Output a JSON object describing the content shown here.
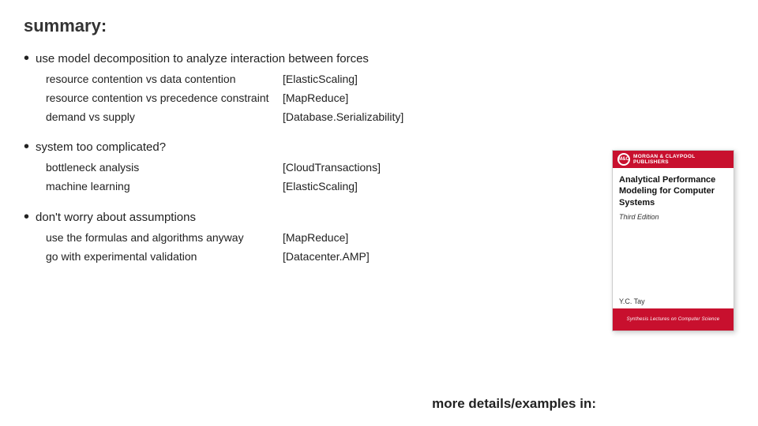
{
  "header": {
    "title": "summary:"
  },
  "bullets": [
    {
      "id": "bullet1",
      "text": "use model decomposition to analyze interaction between forces",
      "indent_items": [
        {
          "label": "resource contention vs data contention",
          "ref": "[ElasticScaling]"
        },
        {
          "label": "resource contention vs precedence constraint",
          "ref": "[MapReduce]"
        },
        {
          "label": "demand vs supply",
          "ref": "[Database.Serializability]"
        }
      ]
    },
    {
      "id": "bullet2",
      "text": "system too complicated?",
      "indent_items": [
        {
          "label": "bottleneck analysis",
          "ref": "[CloudTransactions]"
        },
        {
          "label": "machine learning",
          "ref": "[ElasticScaling]"
        }
      ]
    },
    {
      "id": "bullet3",
      "text": "don't worry about assumptions",
      "indent_items": [
        {
          "label": "use the formulas and algorithms anyway",
          "ref": "[MapReduce]"
        },
        {
          "label": "go with experimental validation",
          "ref": "[Datacenter.AMP]"
        }
      ]
    }
  ],
  "book": {
    "publisher_logo": "M&C",
    "publisher_name": "MORGAN & CLAYPOOL PUBLISHERS",
    "title": "Analytical Performance Modeling for Computer Systems",
    "edition": "Third Edition",
    "author": "Y.C. Tay",
    "series": "Synthesis Lectures on Computer Science"
  },
  "footer": {
    "text": "more details/examples in:"
  }
}
